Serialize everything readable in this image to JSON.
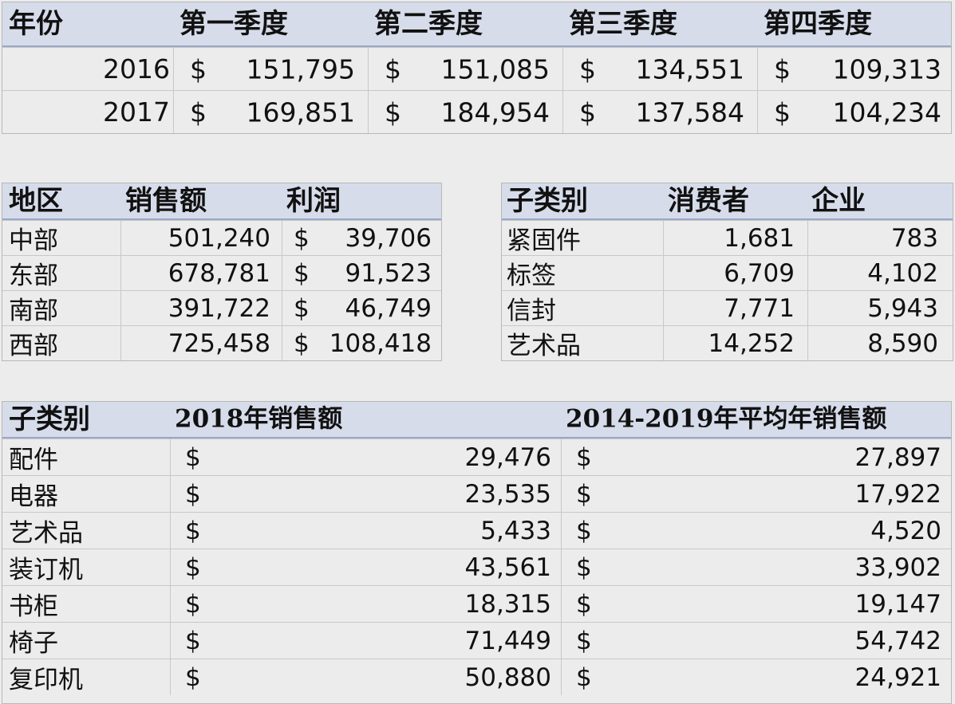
{
  "table1": {
    "headers": [
      "年份",
      "第一季度",
      "第二季度",
      "第三季度",
      "第四季度"
    ],
    "currency": "$",
    "rows": [
      {
        "year": "2016",
        "values": [
          "151,795",
          "151,085",
          "134,551",
          "109,313"
        ]
      },
      {
        "year": "2017",
        "values": [
          "169,851",
          "184,954",
          "137,584",
          "104,234"
        ]
      }
    ]
  },
  "table2": {
    "headers": [
      "地区",
      "销售额",
      "利润"
    ],
    "currency": "$",
    "rows": [
      {
        "region": "中部",
        "sales": "501,240",
        "profit": "39,706"
      },
      {
        "region": "东部",
        "sales": "678,781",
        "profit": "91,523"
      },
      {
        "region": "南部",
        "sales": "391,722",
        "profit": "46,749"
      },
      {
        "region": "西部",
        "sales": "725,458",
        "profit": "108,418"
      }
    ]
  },
  "table3": {
    "headers": [
      "子类别",
      "消费者",
      "企业"
    ],
    "rows": [
      {
        "subcategory": "紧固件",
        "consumer": "1,681",
        "enterprise": "783"
      },
      {
        "subcategory": "标签",
        "consumer": "6,709",
        "enterprise": "4,102"
      },
      {
        "subcategory": "信封",
        "consumer": "7,771",
        "enterprise": "5,943"
      },
      {
        "subcategory": "艺术品",
        "consumer": "14,252",
        "enterprise": "8,590"
      }
    ]
  },
  "table4": {
    "headers": [
      "子类别",
      "2018年销售额",
      "2014-2019年平均年销售额"
    ],
    "currency": "$",
    "rows": [
      {
        "subcategory": "配件",
        "sales2018": "29,476",
        "avg": "27,897"
      },
      {
        "subcategory": "电器",
        "sales2018": "23,535",
        "avg": "17,922"
      },
      {
        "subcategory": "艺术品",
        "sales2018": "5,433",
        "avg": "4,520"
      },
      {
        "subcategory": "装订机",
        "sales2018": "43,561",
        "avg": "33,902"
      },
      {
        "subcategory": "书柜",
        "sales2018": "18,315",
        "avg": "19,147"
      },
      {
        "subcategory": "椅子",
        "sales2018": "71,449",
        "avg": "54,742"
      },
      {
        "subcategory": "复印机",
        "sales2018": "50,880",
        "avg": "24,921"
      }
    ]
  }
}
